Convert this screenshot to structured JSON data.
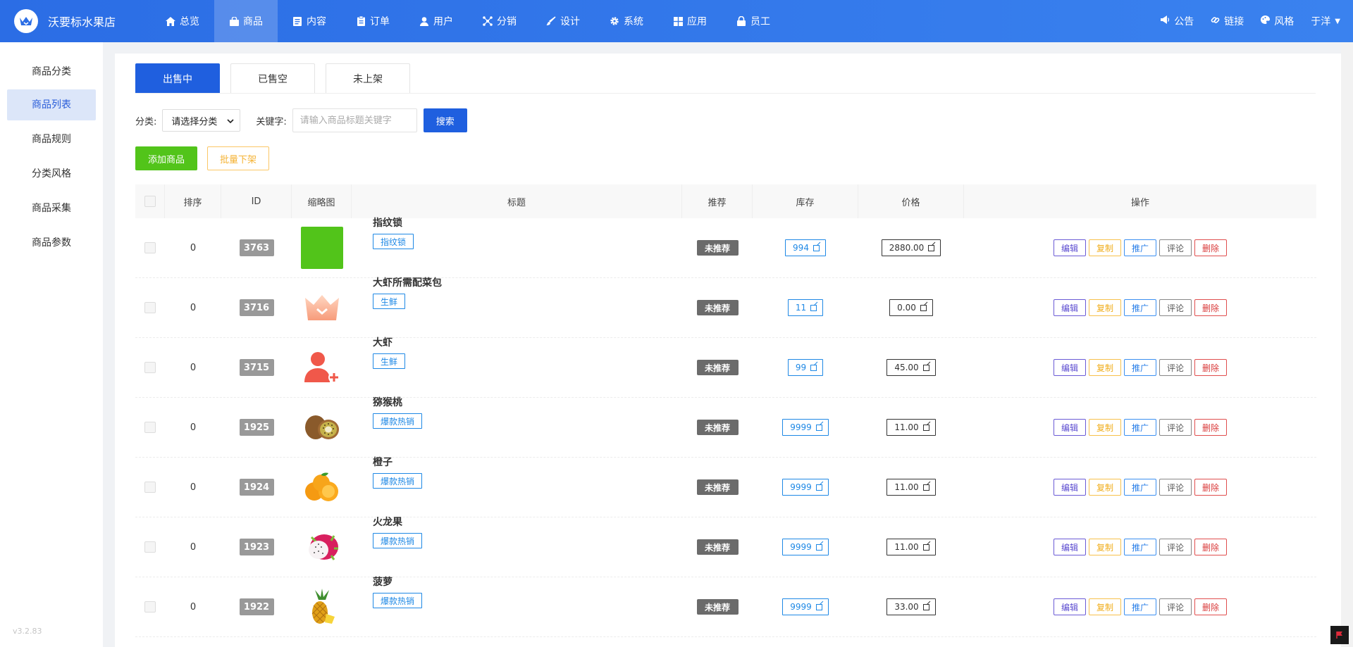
{
  "app": {
    "store_name": "沃要标水果店",
    "version": "v3.2.83",
    "user": "于洋"
  },
  "topnav": [
    {
      "label": "总览",
      "icon": "home-icon"
    },
    {
      "label": "商品",
      "icon": "bag-icon",
      "active": true
    },
    {
      "label": "内容",
      "icon": "document-icon"
    },
    {
      "label": "订单",
      "icon": "clipboard-icon"
    },
    {
      "label": "用户",
      "icon": "user-icon"
    },
    {
      "label": "分销",
      "icon": "network-icon"
    },
    {
      "label": "设计",
      "icon": "brush-icon"
    },
    {
      "label": "系统",
      "icon": "gear-icon"
    },
    {
      "label": "应用",
      "icon": "grid-icon"
    },
    {
      "label": "员工",
      "icon": "lock-icon"
    }
  ],
  "topright": {
    "notice": "公告",
    "link": "链接",
    "style": "风格",
    "user": "于洋"
  },
  "sidebar": {
    "items": [
      {
        "label": "商品分类"
      },
      {
        "label": "商品列表",
        "active": true
      },
      {
        "label": "商品规则"
      },
      {
        "label": "分类风格"
      },
      {
        "label": "商品采集"
      },
      {
        "label": "商品参数"
      }
    ]
  },
  "tabs": [
    {
      "label": "出售中",
      "active": true
    },
    {
      "label": "已售空"
    },
    {
      "label": "未上架"
    }
  ],
  "filter": {
    "category_label": "分类:",
    "category_value": "请选择分类",
    "keyword_label": "关键字:",
    "keyword_placeholder": "请输入商品标题关键字",
    "search_label": "搜索"
  },
  "actions": {
    "add_label": "添加商品",
    "batch_label": "批量下架"
  },
  "table": {
    "headers": {
      "sort": "排序",
      "id": "ID",
      "thumb": "缩略图",
      "title": "标题",
      "recommend": "推荐",
      "stock": "库存",
      "price": "价格",
      "ops": "操作"
    },
    "op_labels": {
      "edit": "编辑",
      "copy": "复制",
      "promo": "推广",
      "review": "评论",
      "delete": "删除"
    },
    "rows": [
      {
        "sort": "0",
        "id": "3763",
        "thumb": "green-square",
        "title": "指纹锁",
        "tag": "指纹锁",
        "recommend": "未推荐",
        "stock": "994",
        "price": "2880.00"
      },
      {
        "sort": "0",
        "id": "3716",
        "thumb": "crown-icon",
        "title": "大虾所需配菜包",
        "tag": "生鲜",
        "recommend": "未推荐",
        "stock": "11",
        "price": "0.00"
      },
      {
        "sort": "0",
        "id": "3715",
        "thumb": "add-user-icon",
        "title": "大虾",
        "tag": "生鲜",
        "recommend": "未推荐",
        "stock": "99",
        "price": "45.00"
      },
      {
        "sort": "0",
        "id": "1925",
        "thumb": "kiwi-image",
        "title": "猕猴桃",
        "tag": "爆款热销",
        "recommend": "未推荐",
        "stock": "9999",
        "price": "11.00"
      },
      {
        "sort": "0",
        "id": "1924",
        "thumb": "orange-image",
        "title": "橙子",
        "tag": "爆款热销",
        "recommend": "未推荐",
        "stock": "9999",
        "price": "11.00"
      },
      {
        "sort": "0",
        "id": "1923",
        "thumb": "dragonfruit-image",
        "title": "火龙果",
        "tag": "爆款热销",
        "recommend": "未推荐",
        "stock": "9999",
        "price": "11.00"
      },
      {
        "sort": "0",
        "id": "1922",
        "thumb": "pineapple-image",
        "title": "菠萝",
        "tag": "爆款热销",
        "recommend": "未推荐",
        "stock": "9999",
        "price": "33.00"
      }
    ]
  },
  "colors": {
    "header_blue": "#2b6de5",
    "primary": "#1f5fdf",
    "add_green": "#52c41a",
    "batch_orange": "#f5b335"
  }
}
